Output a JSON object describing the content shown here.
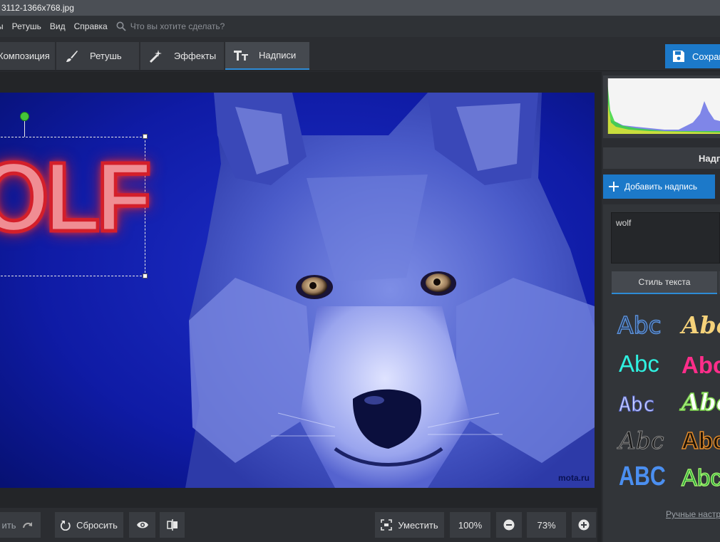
{
  "window": {
    "title": "3112-1366x768.jpg"
  },
  "menu": {
    "items": [
      "ы",
      "Ретушь",
      "Вид",
      "Справка"
    ],
    "search_placeholder": "Что вы хотите сделать?"
  },
  "tabs": [
    {
      "label": "Композиция",
      "icon": "composition-icon"
    },
    {
      "label": "Ретушь",
      "icon": "brush-icon"
    },
    {
      "label": "Эффекты",
      "icon": "magic-wand-icon"
    },
    {
      "label": "Надписи",
      "icon": "text-icon",
      "active": true
    }
  ],
  "save_button": {
    "label": "Сохран",
    "icon": "floppy-disk-icon"
  },
  "canvas": {
    "overlay_text": "OLF",
    "watermark": "mota.ru"
  },
  "bottom_bar": {
    "undo_label": "ить",
    "reset_label": "Сбросить",
    "fit_label": "Уместить",
    "zoom_100_label": "100%",
    "zoom_value": "73%"
  },
  "right_panel": {
    "title": "Надп",
    "add_caption_label": "Добавить надпись",
    "text_value": "wolf",
    "style_tab_label": "Стиль текста",
    "style_samples": [
      "Abc",
      "Abc",
      "Abc",
      "Abc",
      "Abc",
      "Abc",
      "Abc",
      "Abc",
      "ABC",
      "Abc"
    ],
    "manual_settings_label": "Ручные настр"
  },
  "colors": {
    "accent": "#1c79c9",
    "active_tab_underline": "#2d8bd6",
    "panel_bg": "#2b2d31"
  }
}
